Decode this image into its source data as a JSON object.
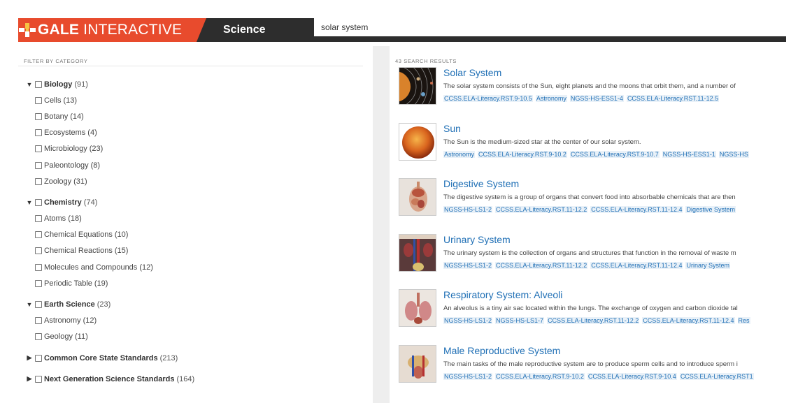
{
  "header": {
    "brand_part1": "GALE",
    "brand_part2": " INTERACTIVE",
    "subject": "Science",
    "search_value": "solar system"
  },
  "filter": {
    "heading": "FILTER BY CATEGORY",
    "groups": [
      {
        "label": "Biology",
        "count": "(91)",
        "expanded": true,
        "children": [
          {
            "label": "Cells",
            "count": "(13)"
          },
          {
            "label": "Botany",
            "count": "(14)"
          },
          {
            "label": "Ecosystems",
            "count": "(4)"
          },
          {
            "label": "Microbiology",
            "count": "(23)"
          },
          {
            "label": "Paleontology",
            "count": "(8)"
          },
          {
            "label": "Zoology",
            "count": "(31)"
          }
        ]
      },
      {
        "label": "Chemistry",
        "count": "(74)",
        "expanded": true,
        "children": [
          {
            "label": "Atoms",
            "count": "(18)"
          },
          {
            "label": "Chemical Equations",
            "count": "(10)"
          },
          {
            "label": "Chemical Reactions",
            "count": "(15)"
          },
          {
            "label": "Molecules and Compounds",
            "count": "(12)"
          },
          {
            "label": "Periodic Table",
            "count": "(19)"
          }
        ]
      },
      {
        "label": "Earth Science",
        "count": "(23)",
        "expanded": true,
        "children": [
          {
            "label": "Astronomy",
            "count": "(12)"
          },
          {
            "label": "Geology",
            "count": "(11)"
          }
        ]
      },
      {
        "label": "Common Core State Standards",
        "count": "(213)",
        "expanded": false,
        "children": []
      },
      {
        "label": "Next Generation Science Standards",
        "count": "(164)",
        "expanded": false,
        "children": []
      }
    ]
  },
  "results": {
    "heading": "43 SEARCH RESULTS",
    "items": [
      {
        "title": "Solar System",
        "desc": "The solar system consists of the Sun, eight planets and the moons that orbit them, and a number of",
        "tags": [
          "CCSS.ELA-Literacy.RST.9-10.5",
          "Astronomy",
          "NGSS-HS-ESS1-4",
          "CCSS.ELA-Literacy.RST.11-12.5"
        ],
        "thumb": "solar"
      },
      {
        "title": "Sun",
        "desc": "The Sun is the medium-sized star at the center of our solar system.",
        "tags": [
          "Astronomy",
          "CCSS.ELA-Literacy.RST.9-10.2",
          "CCSS.ELA-Literacy.RST.9-10.7",
          "NGSS-HS-ESS1-1",
          "NGSS-HS"
        ],
        "thumb": "sun"
      },
      {
        "title": "Digestive System",
        "desc": "The digestive system is a group of organs that convert food into absorbable chemicals that are then",
        "tags": [
          "NGSS-HS-LS1-2",
          "CCSS.ELA-Literacy.RST.11-12.2",
          "CCSS.ELA-Literacy.RST.11-12.4",
          "Digestive System"
        ],
        "thumb": "digestive"
      },
      {
        "title": "Urinary System",
        "desc": "The urinary system is the collection of organs and structures that function in the removal of waste m",
        "tags": [
          "NGSS-HS-LS1-2",
          "CCSS.ELA-Literacy.RST.11-12.2",
          "CCSS.ELA-Literacy.RST.11-12.4",
          "Urinary System"
        ],
        "thumb": "urinary"
      },
      {
        "title": "Respiratory System: Alveoli",
        "desc": "An alveolus is a tiny air sac located within the lungs. The exchange of oxygen and carbon dioxide tal",
        "tags": [
          "NGSS-HS-LS1-2",
          "NGSS-HS-LS1-7",
          "CCSS.ELA-Literacy.RST.11-12.2",
          "CCSS.ELA-Literacy.RST.11-12.4",
          "Res"
        ],
        "thumb": "respiratory"
      },
      {
        "title": "Male Reproductive System",
        "desc": "The main tasks of the male reproductive system are to produce sperm cells and to introduce sperm i",
        "tags": [
          "NGSS-HS-LS1-2",
          "CCSS.ELA-Literacy.RST.9-10.2",
          "CCSS.ELA-Literacy.RST.9-10.4",
          "CCSS.ELA-Literacy.RST1"
        ],
        "thumb": "reproductive"
      }
    ]
  },
  "colors": {
    "brand": "#e84b2d",
    "header_bg": "#2d2d2d",
    "link": "#1f6fb5",
    "tag_bg": "#e9f1f8"
  }
}
